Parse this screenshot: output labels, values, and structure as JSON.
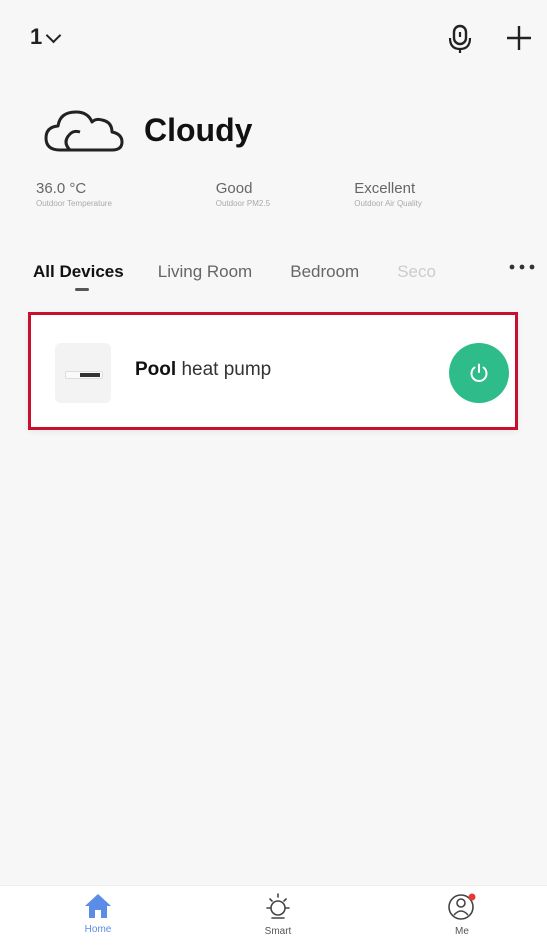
{
  "header": {
    "home_name": "1",
    "mic_icon": "microphone-icon",
    "add_icon": "plus-icon"
  },
  "weather": {
    "icon": "cloud-icon",
    "condition": "Cloudy",
    "stats": [
      {
        "value": "36.0 °C",
        "label": "Outdoor Temperature"
      },
      {
        "value": "Good",
        "label": "Outdoor PM2.5"
      },
      {
        "value": "Excellent",
        "label": "Outdoor Air Quality"
      }
    ]
  },
  "tabs": {
    "items": [
      {
        "label": "All Devices",
        "active": true
      },
      {
        "label": "Living Room",
        "active": false
      },
      {
        "label": "Bedroom",
        "active": false
      },
      {
        "label": "Seco",
        "active": false
      }
    ],
    "more_icon": "more-icon"
  },
  "devices": [
    {
      "name_bold": "Pool",
      "name_rest": " heat pump",
      "power_icon": "power-icon",
      "highlight_color": "#c8102e",
      "power_color": "#2ebd8a"
    }
  ],
  "bottom_nav": {
    "items": [
      {
        "label": "Home",
        "icon": "home-icon",
        "active": true
      },
      {
        "label": "Smart",
        "icon": "sun-icon",
        "active": false
      },
      {
        "label": "Me",
        "icon": "user-icon",
        "active": false
      }
    ],
    "accent_color": "#5b8ce6"
  }
}
